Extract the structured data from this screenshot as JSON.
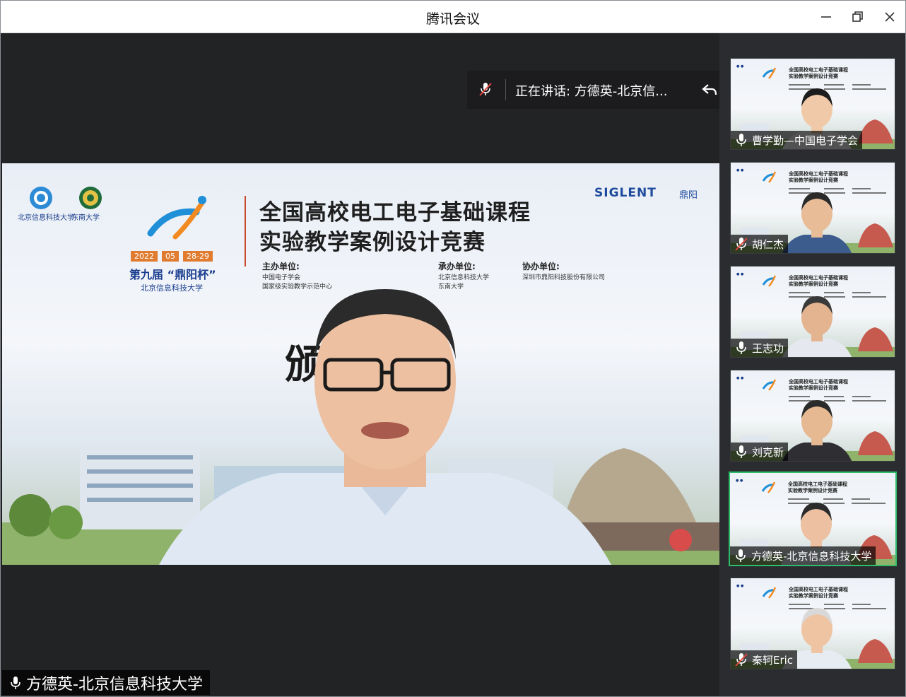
{
  "app": {
    "title": "腾讯会议"
  },
  "window_controls": {
    "minimize": "minimize-icon",
    "restore": "restore-icon",
    "close": "close-icon"
  },
  "speaking": {
    "label": "正在讲话: 方德英-北京信..."
  },
  "main_speaker": {
    "name": "方德英-北京信息科技大学"
  },
  "slide": {
    "title_line1": "全国高校电工电子基础课程",
    "title_line2": "实验教学案例设计竞赛",
    "dates": [
      "2022",
      "05",
      "28-29"
    ],
    "edition": "第九届 “鼎阳杯”",
    "host_univ": "北京信息科技大学",
    "logo_left_text": "北京信息科技大学",
    "logo_right_text": "东南大学",
    "organizer_head": "主办单位:",
    "organizer_text": "中国电子学会\n国家级实验教学示范中心",
    "undertaker_head": "承办单位:",
    "undertaker_text": "北京信息科技大学\n东南大学",
    "coorganizer_head": "协办单位:",
    "coorganizer_text": "深圳市鼎阳科技股份有限公司",
    "brand": "SIGLENT",
    "brand_cn": "鼎阳",
    "partial_char": "颁"
  },
  "participants": [
    {
      "name": "曹学勤—中国电子学会",
      "muted": false,
      "active": false
    },
    {
      "name": "胡仁杰",
      "muted": true,
      "active": false
    },
    {
      "name": "王志功",
      "muted": false,
      "active": false
    },
    {
      "name": "刘克新",
      "muted": false,
      "active": false
    },
    {
      "name": "方德英-北京信息科技大学",
      "muted": false,
      "active": true
    },
    {
      "name": "秦轲Eric",
      "muted": true,
      "active": false
    }
  ],
  "thumb_slide_title": "全国高校电工电子基础课程\n实验教学案例设计竞赛",
  "colors": {
    "active_border": "#2fbd6b",
    "muted_red": "#e2463d",
    "accent_blue": "#1b3f8f"
  }
}
